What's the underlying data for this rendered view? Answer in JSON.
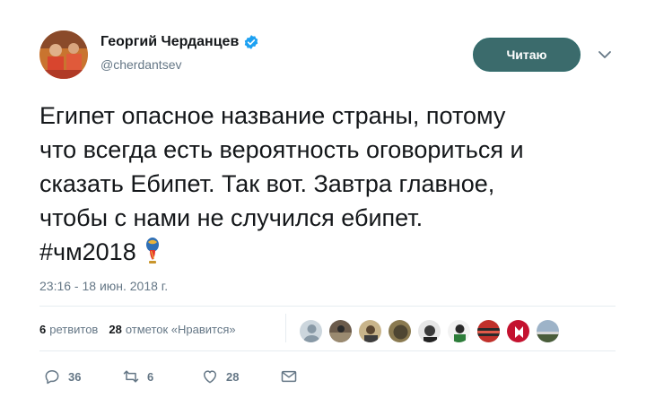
{
  "author": {
    "display_name": "Георгий Черданцев",
    "handle": "@cherdantsev",
    "avatar_icon": "user-avatar",
    "verified_icon": "verified-badge-icon"
  },
  "follow_button": {
    "label": "Читаю"
  },
  "menu_icon": "chevron-down-icon",
  "tweet": {
    "lines": [
      "Египет опасное название страны, потому",
      "что всегда есть вероятность оговориться и",
      "сказать Ебипет. Так вот. Завтра главное,",
      "чтобы с нами не случился ебипет.",
      "#чм2018"
    ],
    "emoji_icon": "world-cup-trophy-icon"
  },
  "timestamp": "23:16 - 18 июн. 2018 г.",
  "stats": {
    "retweets_count": "6",
    "retweets_label": "ретвитов",
    "likes_count": "28",
    "likes_label": "отметок «Нравится»"
  },
  "likers_count_shown": 9,
  "actions": {
    "reply_count": "36",
    "retweet_count": "6",
    "like_count": "28"
  },
  "colors": {
    "follow_button_bg": "#3b6b6c",
    "verified_blue": "#1da1f2",
    "muted_text": "#657786",
    "divider": "#e6ecf0"
  }
}
